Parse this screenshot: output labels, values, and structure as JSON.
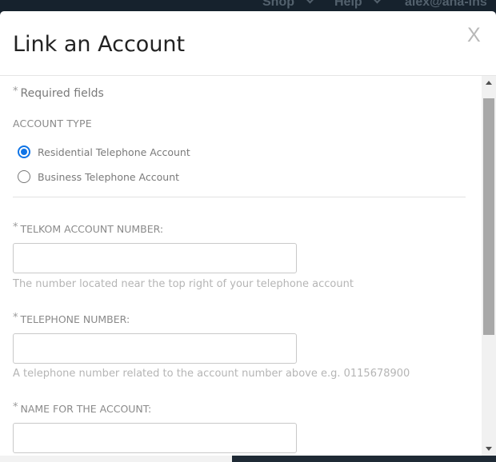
{
  "topnav": {
    "shop": "Shop",
    "help": "Help",
    "user": "alex@ana-ins"
  },
  "modal": {
    "title": "Link an Account",
    "close_label": "X",
    "required_star": "*",
    "required_note": "Required fields",
    "account_type_label": "ACCOUNT TYPE",
    "account_types": [
      {
        "label": "Residential Telephone Account",
        "checked": true
      },
      {
        "label": "Business Telephone Account",
        "checked": false
      }
    ],
    "fields": [
      {
        "label": "TELKOM ACCOUNT NUMBER:",
        "value": "",
        "help": "The number located near the top right of your telephone account"
      },
      {
        "label": "TELEPHONE NUMBER:",
        "value": "",
        "help": "A telephone number related to the account number above e.g. 0115678900"
      },
      {
        "label": "NAME FOR THE ACCOUNT:",
        "value": "",
        "help": ""
      }
    ]
  },
  "colors": {
    "accent": "#0f74e6",
    "backdrop": "#1f2a35"
  }
}
